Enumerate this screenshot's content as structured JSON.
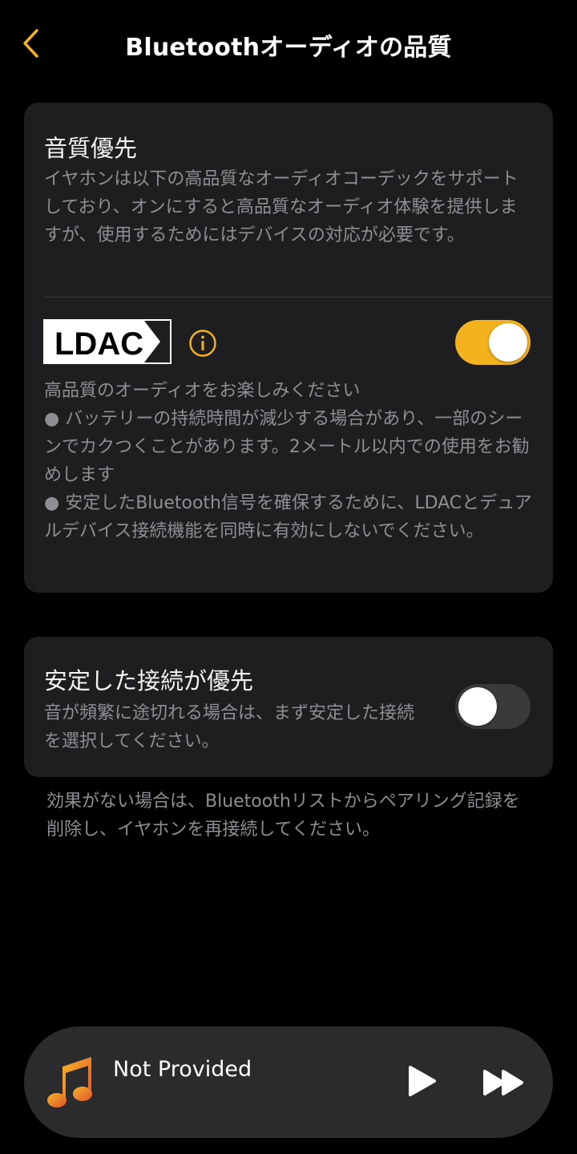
{
  "header": {
    "title": "Bluetoothオーディオの品質"
  },
  "sound_quality": {
    "title": "音質優先",
    "description": "イヤホンは以下の高品質なオーディオコーデックをサポートしており、オンにすると高品質なオーディオ体験を提供しますが、使用するためにはデバイスの対応が必要です。",
    "codec": {
      "logo_text": "LDAC",
      "enabled": true,
      "line1": "高品質のオーディオをお楽しみください",
      "line2": "● バッテリーの持続時間が減少する場合があり、一部のシーンでカクつくことがあります。2メートル以内での使用をお勧めします",
      "line3": "● 安定したBluetooth信号を確保するために、LDACとデュアルデバイス接続機能を同時に有効にしないでください。"
    }
  },
  "stable_connection": {
    "title": "安定した接続が優先",
    "description": "音が頻繁に途切れる場合は、まず安定した接続を選択してください。",
    "enabled": false
  },
  "footer_note": "効果がない場合は、Bluetoothリストからペアリング記録を削除し、イヤホンを再接続してください。",
  "player": {
    "track_title": "Not Provided"
  },
  "colors": {
    "accent": "#f5b21f",
    "card": "#1e1e20",
    "player": "#2b2b2d",
    "muted_text": "#8f8f93"
  }
}
